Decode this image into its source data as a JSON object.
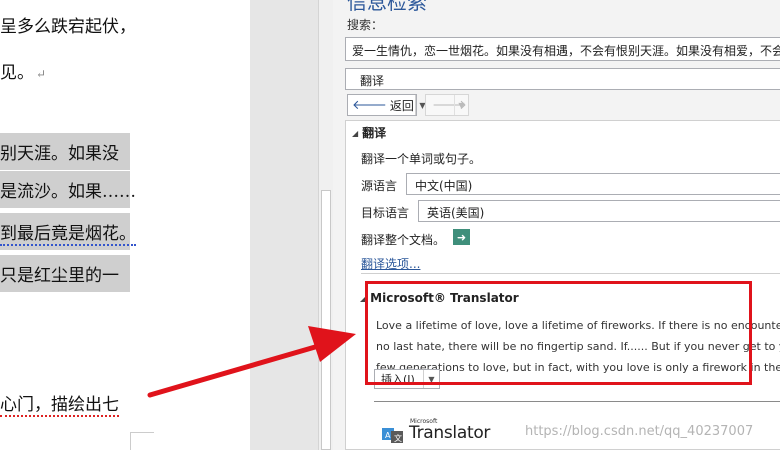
{
  "document": {
    "lines": [
      "呈多么跌宕起伏，",
      "见。",
      "别天涯。如果没",
      "是流沙。如果……",
      "到最后竟是烟花。",
      "只是红尘里的一",
      "心门，描绘出七"
    ],
    "paragraph_mark": "↵"
  },
  "pane": {
    "title": "信息检索",
    "search_label": "搜索：",
    "search_value": "爱一生情仇，恋一世烟花。如果没有相遇，不会有恨别天涯。如果没有相爱，不会",
    "service": "翻译",
    "back_label": "返回",
    "back_icon": "arrow-left-icon",
    "forward_icon": "arrow-right-icon",
    "translate_section": {
      "heading": "翻译",
      "instruction": "翻译一个单词或句子。",
      "source_label": "源语言",
      "source_value": "中文(中国)",
      "target_label": "目标语言",
      "target_value": "英语(美国)",
      "whole_doc_label": "翻译整个文档。",
      "options_link": "翻译选项..."
    },
    "ms_section": {
      "heading": "Microsoft® Translator",
      "lines": [
        "Love a lifetime of love, love a lifetime of fireworks. If there is no encounter, there w",
        "no last hate, there will be no fingertip sand. If...... But if you never get to yourself.",
        "few generations to love, but in fact, with you love is only a firework in the red dust."
      ],
      "insert_label": "插入(I)",
      "logo_small": "Microsoft",
      "logo_word": "Translator"
    }
  },
  "watermark": "https://blog.csdn.net/qq_40237007",
  "colors": {
    "accent": "#2b579a",
    "annotation": "#e0131b",
    "highlight": "#cfcfcf"
  }
}
